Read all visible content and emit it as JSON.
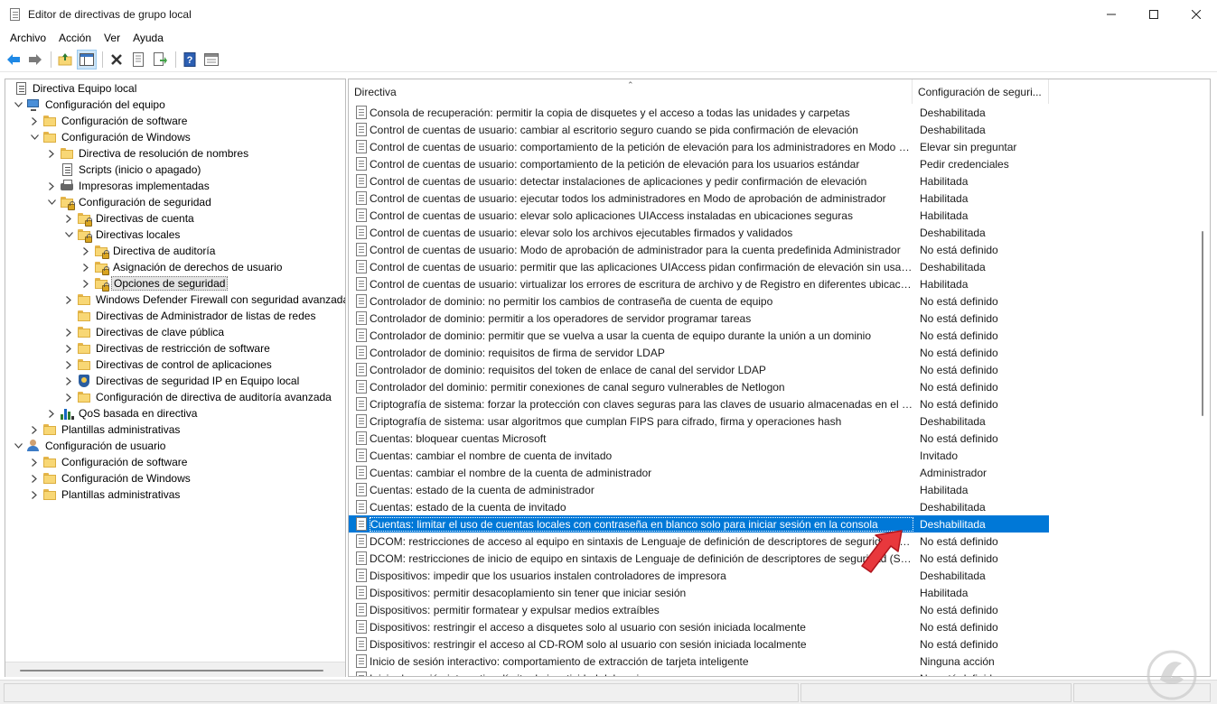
{
  "window": {
    "title": "Editor de directivas de grupo local",
    "minimize_glyph": "—",
    "maximize_glyph": "☐",
    "close_glyph": "✕"
  },
  "menu": [
    "Archivo",
    "Acción",
    "Ver",
    "Ayuda"
  ],
  "toolbar": {
    "icons": [
      "back-icon",
      "forward-icon",
      "up-folder-icon",
      "show-hide-tree-icon",
      "delete-icon",
      "properties-icon",
      "export-list-icon",
      "help-icon",
      "console-view-icon"
    ]
  },
  "tree": {
    "items": [
      {
        "label": "Directiva Equipo local",
        "level": 0,
        "icon": "policy-icon",
        "expander": "none"
      },
      {
        "label": "Configuración del equipo",
        "level": 0,
        "icon": "computer-icon",
        "expander": "expanded"
      },
      {
        "label": "Configuración de software",
        "level": 1,
        "icon": "folder-icon",
        "expander": "collapsed"
      },
      {
        "label": "Configuración de Windows",
        "level": 1,
        "icon": "folder-icon",
        "expander": "expanded"
      },
      {
        "label": "Directiva de resolución de nombres",
        "level": 2,
        "icon": "folder-icon",
        "expander": "collapsed"
      },
      {
        "label": "Scripts (inicio o apagado)",
        "level": 2,
        "icon": "script-icon",
        "expander": "none"
      },
      {
        "label": "Impresoras implementadas",
        "level": 2,
        "icon": "printer-icon",
        "expander": "collapsed"
      },
      {
        "label": "Configuración de seguridad",
        "level": 2,
        "icon": "secure-folder-icon",
        "expander": "expanded"
      },
      {
        "label": "Directivas de cuenta",
        "level": 3,
        "icon": "secure-folder-icon",
        "expander": "collapsed"
      },
      {
        "label": "Directivas locales",
        "level": 3,
        "icon": "secure-folder-icon",
        "expander": "expanded"
      },
      {
        "label": "Directiva de auditoría",
        "level": 4,
        "icon": "secure-folder-icon",
        "expander": "collapsed"
      },
      {
        "label": "Asignación de derechos de usuario",
        "level": 4,
        "icon": "secure-folder-icon",
        "expander": "collapsed"
      },
      {
        "label": "Opciones de seguridad",
        "level": 4,
        "icon": "secure-folder-icon",
        "expander": "collapsed",
        "selected": true
      },
      {
        "label": "Windows Defender Firewall con seguridad avanzada",
        "level": 3,
        "icon": "folder-icon",
        "expander": "collapsed"
      },
      {
        "label": "Directivas de Administrador de listas de redes",
        "level": 3,
        "icon": "folder-icon",
        "expander": "none"
      },
      {
        "label": "Directivas de clave pública",
        "level": 3,
        "icon": "folder-icon",
        "expander": "collapsed"
      },
      {
        "label": "Directivas de restricción de software",
        "level": 3,
        "icon": "folder-icon",
        "expander": "collapsed"
      },
      {
        "label": "Directivas de control de aplicaciones",
        "level": 3,
        "icon": "folder-icon",
        "expander": "collapsed"
      },
      {
        "label": "Directivas de seguridad IP en Equipo local",
        "level": 3,
        "icon": "ipsec-icon",
        "expander": "collapsed"
      },
      {
        "label": "Configuración de directiva de auditoría avanzada",
        "level": 3,
        "icon": "folder-icon",
        "expander": "collapsed"
      },
      {
        "label": "QoS basada en directiva",
        "level": 2,
        "icon": "chart-icon",
        "expander": "collapsed"
      },
      {
        "label": "Plantillas administrativas",
        "level": 1,
        "icon": "folder-icon",
        "expander": "collapsed"
      },
      {
        "label": "Configuración de usuario",
        "level": 0,
        "icon": "user-icon",
        "expander": "expanded"
      },
      {
        "label": "Configuración de software",
        "level": 1,
        "icon": "folder-icon",
        "expander": "collapsed"
      },
      {
        "label": "Configuración de Windows",
        "level": 1,
        "icon": "folder-icon",
        "expander": "collapsed"
      },
      {
        "label": "Plantillas administrativas",
        "level": 1,
        "icon": "folder-icon",
        "expander": "collapsed"
      }
    ]
  },
  "list": {
    "columns": [
      "Directiva",
      "Configuración de seguri..."
    ],
    "rows": [
      {
        "name": "Consola de recuperación: permitir la copia de disquetes y el acceso a todas las unidades y carpetas",
        "value": "Deshabilitada"
      },
      {
        "name": "Control de cuentas de usuario: cambiar al escritorio seguro cuando se pida confirmación de elevación",
        "value": "Deshabilitada"
      },
      {
        "name": "Control de cuentas de usuario: comportamiento de la petición de elevación para los administradores en Modo d...",
        "value": "Elevar sin preguntar"
      },
      {
        "name": "Control de cuentas de usuario: comportamiento de la petición de elevación para los usuarios estándar",
        "value": "Pedir credenciales"
      },
      {
        "name": "Control de cuentas de usuario: detectar instalaciones de aplicaciones y pedir confirmación de elevación",
        "value": "Habilitada"
      },
      {
        "name": "Control de cuentas de usuario: ejecutar todos los administradores en Modo de aprobación de administrador",
        "value": "Habilitada"
      },
      {
        "name": "Control de cuentas de usuario: elevar solo aplicaciones UIAccess instaladas en ubicaciones seguras",
        "value": "Habilitada"
      },
      {
        "name": "Control de cuentas de usuario: elevar solo los archivos ejecutables firmados y validados",
        "value": "Deshabilitada"
      },
      {
        "name": "Control de cuentas de usuario: Modo de aprobación de administrador para la cuenta predefinida Administrador",
        "value": "No está definido"
      },
      {
        "name": "Control de cuentas de usuario: permitir que las aplicaciones UIAccess pidan confirmación de elevación sin usar ...",
        "value": "Deshabilitada"
      },
      {
        "name": "Control de cuentas de usuario: virtualizar los errores de escritura de archivo y de Registro en diferentes ubicacion...",
        "value": "Habilitada"
      },
      {
        "name": "Controlador de dominio: no permitir los cambios de contraseña de cuenta de equipo",
        "value": "No está definido"
      },
      {
        "name": "Controlador de dominio: permitir a los operadores de servidor programar tareas",
        "value": "No está definido"
      },
      {
        "name": "Controlador de dominio: permitir que se vuelva a usar la cuenta de equipo durante la unión a un dominio",
        "value": "No está definido"
      },
      {
        "name": "Controlador de dominio: requisitos de firma de servidor LDAP",
        "value": "No está definido"
      },
      {
        "name": "Controlador de dominio: requisitos del token de enlace de canal del servidor LDAP",
        "value": "No está definido"
      },
      {
        "name": "Controlador del dominio: permitir conexiones de canal seguro vulnerables de Netlogon",
        "value": "No está definido"
      },
      {
        "name": "Criptografía de sistema: forzar la protección con claves seguras para las claves de usuario almacenadas en el equ...",
        "value": "No está definido"
      },
      {
        "name": "Criptografía de sistema: usar algoritmos que cumplan FIPS para cifrado, firma y operaciones hash",
        "value": "Deshabilitada"
      },
      {
        "name": "Cuentas: bloquear cuentas Microsoft",
        "value": "No está definido"
      },
      {
        "name": "Cuentas: cambiar el nombre de cuenta de invitado",
        "value": "Invitado"
      },
      {
        "name": "Cuentas: cambiar el nombre de la cuenta de administrador",
        "value": "Administrador"
      },
      {
        "name": "Cuentas: estado de la cuenta de administrador",
        "value": "Habilitada"
      },
      {
        "name": "Cuentas: estado de la cuenta de invitado",
        "value": "Deshabilitada"
      },
      {
        "name": "Cuentas: limitar el uso de cuentas locales con contraseña en blanco solo para iniciar sesión en la consola",
        "value": "Deshabilitada",
        "selected": true
      },
      {
        "name": "DCOM: restricciones de acceso al equipo en sintaxis de Lenguaje de definición de descriptores de seguridad (SD...",
        "value": "No está definido"
      },
      {
        "name": "DCOM: restricciones de inicio de equipo en sintaxis de Lenguaje de definición de descriptores de seguridad (SD...",
        "value": "No está definido"
      },
      {
        "name": "Dispositivos: impedir que los usuarios instalen controladores de impresora",
        "value": "Deshabilitada"
      },
      {
        "name": "Dispositivos: permitir desacoplamiento sin tener que iniciar sesión",
        "value": "Habilitada"
      },
      {
        "name": "Dispositivos: permitir formatear y expulsar medios extraíbles",
        "value": "No está definido"
      },
      {
        "name": "Dispositivos: restringir el acceso a disquetes solo al usuario con sesión iniciada localmente",
        "value": "No está definido"
      },
      {
        "name": "Dispositivos: restringir el acceso al CD-ROM solo al usuario con sesión iniciada localmente",
        "value": "No está definido"
      },
      {
        "name": "Inicio de sesión interactivo: comportamiento de extracción de tarjeta inteligente",
        "value": "Ninguna acción"
      },
      {
        "name": "Inicio de sesión interactivo: límite de inactividad del equipo",
        "value": "No está definido"
      }
    ]
  },
  "colors": {
    "selection": "#0078d7",
    "annotation_arrow": "#e8383d"
  }
}
